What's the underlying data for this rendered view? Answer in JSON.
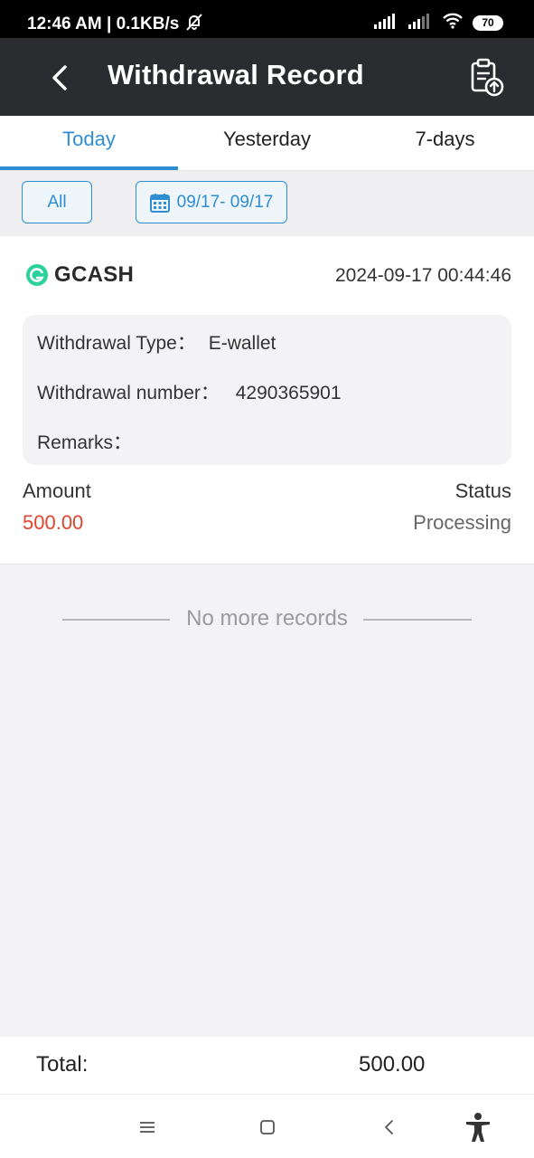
{
  "status_bar": {
    "time_speed": "12:46 AM | 0.1KB/s",
    "battery": "70"
  },
  "header": {
    "title": "Withdrawal Record"
  },
  "tabs": [
    {
      "label": "Today",
      "active": true
    },
    {
      "label": "Yesterday",
      "active": false
    },
    {
      "label": "7-days",
      "active": false
    }
  ],
  "filters": {
    "all_label": "All",
    "date_range": "09/17- 09/17"
  },
  "record": {
    "brand": "GCASH",
    "datetime": "2024-09-17 00:44:46",
    "type_label": "Withdrawal Type：",
    "type_value": "E-wallet",
    "number_label": "Withdrawal number：",
    "number_value": "4290365901",
    "remarks_label": "Remarks：",
    "amount_label": "Amount",
    "amount_value": "500.00",
    "status_label": "Status",
    "status_value": "Processing"
  },
  "no_more_text": "No more records",
  "total": {
    "label": "Total:",
    "value": "500.00"
  },
  "colors": {
    "accent": "#2f8ed2",
    "amount": "#e0452c",
    "header_bg": "#2b2c2f",
    "gcash_green": "#2bd19b"
  }
}
